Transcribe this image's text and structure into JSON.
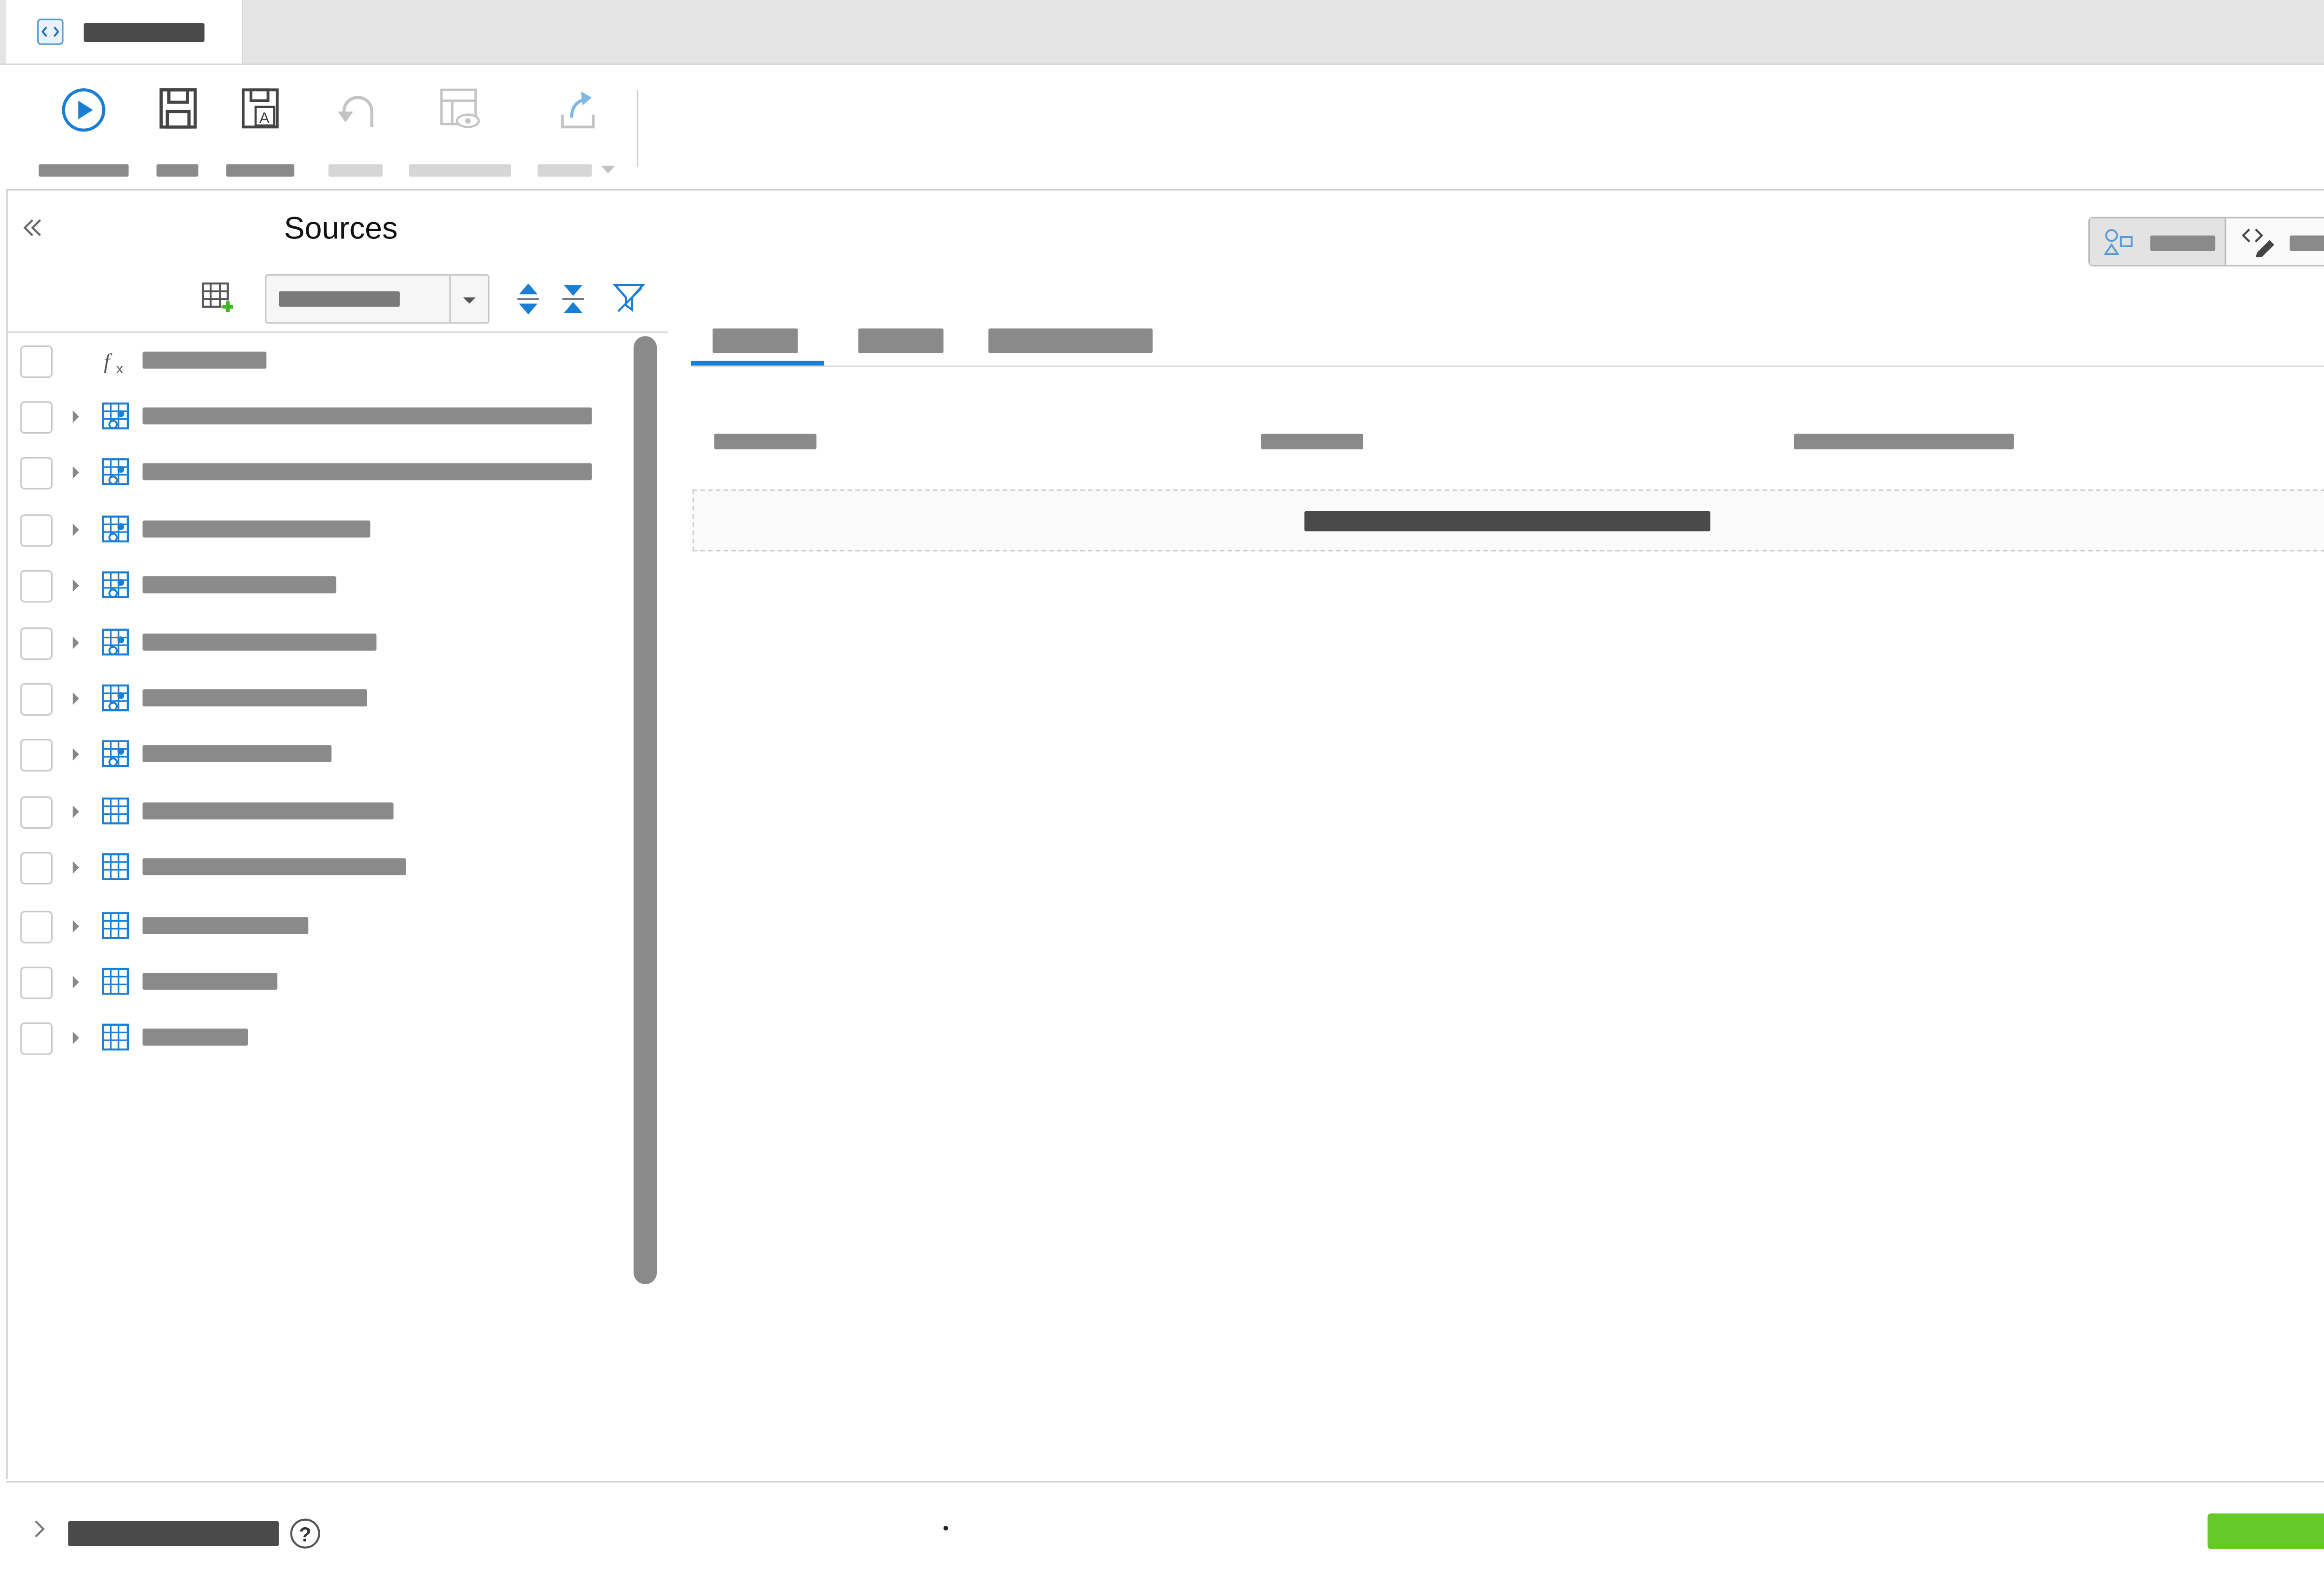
{
  "sources_panel": {
    "title": "Sources"
  },
  "colors": {
    "accent": "#1a7fd4",
    "primary_button": "#66c92a",
    "placeholder_bar": "#8a8a8a",
    "dark_bar": "#4a4a4a"
  },
  "toolbar": {
    "buttons": [
      "run-icon",
      "save-icon",
      "save-as-icon",
      "undo-icon",
      "preview-icon",
      "export-icon"
    ]
  },
  "tree": {
    "rows": [
      {
        "icon": "function-icon",
        "expandable": false
      },
      {
        "icon": "linked-table-icon",
        "expandable": true
      },
      {
        "icon": "linked-table-icon",
        "expandable": true
      },
      {
        "icon": "linked-table-icon",
        "expandable": true
      },
      {
        "icon": "linked-table-icon",
        "expandable": true
      },
      {
        "icon": "linked-table-icon",
        "expandable": true
      },
      {
        "icon": "linked-table-icon",
        "expandable": true
      },
      {
        "icon": "linked-table-icon",
        "expandable": true
      },
      {
        "icon": "table-icon",
        "expandable": true
      },
      {
        "icon": "table-icon",
        "expandable": true
      },
      {
        "icon": "table-icon",
        "expandable": true
      },
      {
        "icon": "table-icon",
        "expandable": true
      },
      {
        "icon": "table-icon",
        "expandable": true
      }
    ]
  }
}
